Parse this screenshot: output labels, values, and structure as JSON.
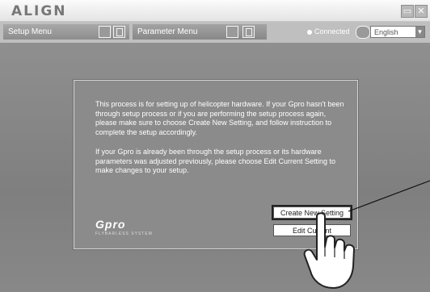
{
  "app": {
    "brand": "ALIGN"
  },
  "window_controls": {
    "minimize": "▭",
    "close": "✕"
  },
  "toolbar": {
    "setup_menu_label": "Setup Menu",
    "parameter_menu_label": "Parameter Menu",
    "status_text": "Connected",
    "language": {
      "selected": "English"
    }
  },
  "dialog": {
    "paragraph1": "This process is for setting up of helicopter hardware. If your Gpro hasn't been through setup process or if you are performing the setup process again, please make sure to choose Create New Setting, and follow instruction to complete the setup accordingly.",
    "paragraph2": "If your Gpro is already been through the setup process or its hardware parameters was adjusted previously, please choose Edit Current Setting to make changes to your setup.",
    "logo_mark": "Gpro",
    "logo_subtitle": "FLYBARLESS SYSTEM",
    "create_button": "Create New Setting",
    "edit_button": "Edit Current"
  },
  "colors": {
    "accent": "#ffffff",
    "panel": "#8b8b8b",
    "toolbar": "#bfbfbf"
  },
  "icons": [
    "folder-icon",
    "document-icon",
    "globe-icon",
    "pointing-hand-icon"
  ]
}
